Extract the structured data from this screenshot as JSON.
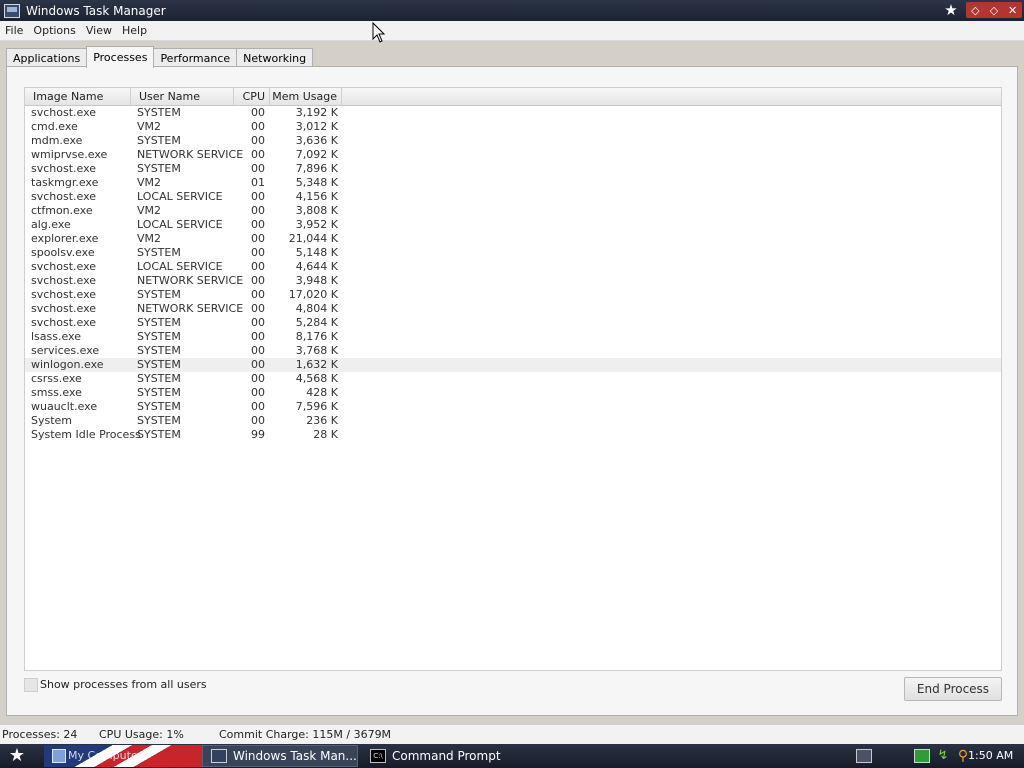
{
  "window": {
    "title": "Windows Task Manager"
  },
  "menu": [
    "File",
    "Options",
    "View",
    "Help"
  ],
  "tabs": [
    "Applications",
    "Processes",
    "Performance",
    "Networking"
  ],
  "active_tab": "Processes",
  "columns": {
    "image_name": "Image Name",
    "user_name": "User Name",
    "cpu": "CPU",
    "mem_usage": "Mem Usage"
  },
  "processes": [
    {
      "image": "svchost.exe",
      "user": "SYSTEM",
      "cpu": "00",
      "mem": "3,192 K"
    },
    {
      "image": "cmd.exe",
      "user": "VM2",
      "cpu": "00",
      "mem": "3,012 K"
    },
    {
      "image": "mdm.exe",
      "user": "SYSTEM",
      "cpu": "00",
      "mem": "3,636 K"
    },
    {
      "image": "wmiprvse.exe",
      "user": "NETWORK SERVICE",
      "cpu": "00",
      "mem": "7,092 K"
    },
    {
      "image": "svchost.exe",
      "user": "SYSTEM",
      "cpu": "00",
      "mem": "7,896 K"
    },
    {
      "image": "taskmgr.exe",
      "user": "VM2",
      "cpu": "01",
      "mem": "5,348 K"
    },
    {
      "image": "svchost.exe",
      "user": "LOCAL SERVICE",
      "cpu": "00",
      "mem": "4,156 K"
    },
    {
      "image": "ctfmon.exe",
      "user": "VM2",
      "cpu": "00",
      "mem": "3,808 K"
    },
    {
      "image": "alg.exe",
      "user": "LOCAL SERVICE",
      "cpu": "00",
      "mem": "3,952 K"
    },
    {
      "image": "explorer.exe",
      "user": "VM2",
      "cpu": "00",
      "mem": "21,044 K"
    },
    {
      "image": "spoolsv.exe",
      "user": "SYSTEM",
      "cpu": "00",
      "mem": "5,148 K"
    },
    {
      "image": "svchost.exe",
      "user": "LOCAL SERVICE",
      "cpu": "00",
      "mem": "4,644 K"
    },
    {
      "image": "svchost.exe",
      "user": "NETWORK SERVICE",
      "cpu": "00",
      "mem": "3,948 K"
    },
    {
      "image": "svchost.exe",
      "user": "SYSTEM",
      "cpu": "00",
      "mem": "17,020 K"
    },
    {
      "image": "svchost.exe",
      "user": "NETWORK SERVICE",
      "cpu": "00",
      "mem": "4,804 K"
    },
    {
      "image": "svchost.exe",
      "user": "SYSTEM",
      "cpu": "00",
      "mem": "5,284 K"
    },
    {
      "image": "lsass.exe",
      "user": "SYSTEM",
      "cpu": "00",
      "mem": "8,176 K"
    },
    {
      "image": "services.exe",
      "user": "SYSTEM",
      "cpu": "00",
      "mem": "3,768 K"
    },
    {
      "image": "winlogon.exe",
      "user": "SYSTEM",
      "cpu": "00",
      "mem": "1,632 K"
    },
    {
      "image": "csrss.exe",
      "user": "SYSTEM",
      "cpu": "00",
      "mem": "4,568 K"
    },
    {
      "image": "smss.exe",
      "user": "SYSTEM",
      "cpu": "00",
      "mem": "428 K"
    },
    {
      "image": "wuauclt.exe",
      "user": "SYSTEM",
      "cpu": "00",
      "mem": "7,596 K"
    },
    {
      "image": "System",
      "user": "SYSTEM",
      "cpu": "00",
      "mem": "236 K"
    },
    {
      "image": "System Idle Process",
      "user": "SYSTEM",
      "cpu": "99",
      "mem": "28 K"
    }
  ],
  "selected_row": 18,
  "show_all_users_label": "Show processes from all users",
  "end_process_label": "End Process",
  "status": {
    "processes": "Processes: 24",
    "cpu_usage": "CPU Usage: 1%",
    "commit_charge": "Commit Charge: 115M / 3679M"
  },
  "taskbar": {
    "items": [
      {
        "label": "My Computer",
        "icon": "computer-icon"
      },
      {
        "label": "Windows Task Man...",
        "icon": "task-manager-icon"
      },
      {
        "label": "Command Prompt",
        "icon": "command-prompt-icon"
      }
    ],
    "clock": "1:50 AM"
  },
  "colors": {
    "title_bar": "#222a3b",
    "window_controls": "#b3352f",
    "taskbar": "#1f2635",
    "panel": "#f6f6f6"
  }
}
